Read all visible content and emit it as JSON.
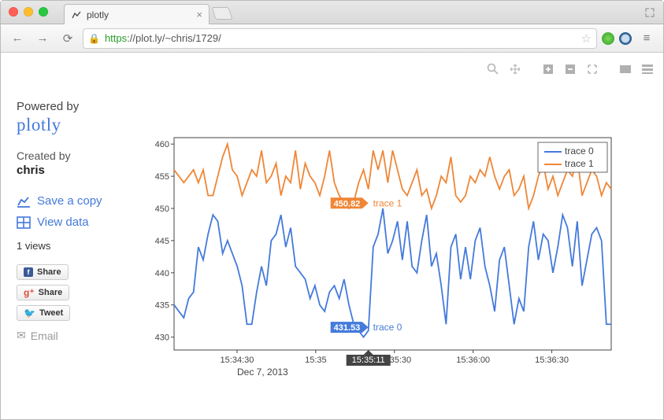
{
  "browser": {
    "tab_title": "plotly",
    "url_protocol": "https",
    "url_rest": "://plot.ly/~chris/1729/"
  },
  "toolbar": {
    "zoom": "Zoom",
    "pan": "Pan",
    "plus": "+",
    "minus": "−",
    "autoscale": "Autoscale"
  },
  "sidebar": {
    "powered_by": "Powered by",
    "logo": "plotly",
    "created_by": "Created by",
    "author": "chris",
    "save_copy": "Save a copy",
    "view_data": "View data",
    "views": "1 views",
    "share_fb": "Share",
    "share_gp": "Share",
    "share_tw": "Tweet",
    "email": "Email"
  },
  "chart_data": {
    "type": "line",
    "xlabel": "",
    "ylabel": "",
    "date_annotation": "Dec 7, 2013",
    "xticks": [
      "15:34:30",
      "15:35",
      "15:35:30",
      "15:36:00",
      "15:36:30"
    ],
    "yticks": [
      430,
      435,
      440,
      445,
      450,
      455,
      460
    ],
    "ylim": [
      428,
      461
    ],
    "legend": [
      "trace 0",
      "trace 1"
    ],
    "hover": {
      "x": "15:35:11",
      "trace0_value": "431.53",
      "trace0_name": "trace 0",
      "trace1_value": "450.82",
      "trace1_name": "trace 1"
    },
    "series": [
      {
        "name": "trace 0",
        "color": "#447adb",
        "values": [
          435,
          434,
          433,
          436,
          437,
          444,
          442,
          446,
          449,
          448,
          443,
          445,
          443,
          441,
          438,
          432,
          432,
          437,
          441,
          438,
          445,
          446,
          449,
          444,
          447,
          441,
          440,
          439,
          436,
          438,
          435,
          434,
          437,
          438,
          436,
          439,
          435,
          432,
          431,
          430,
          431,
          444,
          446,
          450,
          443,
          445,
          448,
          442,
          448,
          441,
          440,
          445,
          449,
          441,
          443,
          438,
          432,
          444,
          446,
          439,
          444,
          439,
          445,
          447,
          441,
          438,
          434,
          442,
          444,
          438,
          432,
          436,
          434,
          444,
          448,
          442,
          446,
          445,
          440,
          444,
          449,
          447,
          441,
          448,
          438,
          442,
          446,
          447,
          445,
          432,
          432
        ]
      },
      {
        "name": "trace 1",
        "color": "#ef8636",
        "values": [
          456,
          455,
          454,
          455,
          456,
          454,
          456,
          452,
          452,
          455,
          458,
          460,
          456,
          455,
          452,
          454,
          456,
          455,
          459,
          454,
          455,
          457,
          452,
          455,
          454,
          459,
          453,
          457,
          455,
          454,
          452,
          455,
          459,
          454,
          452,
          451,
          450,
          451,
          454,
          456,
          453,
          459,
          456,
          459,
          454,
          459,
          456,
          453,
          452,
          454,
          456,
          452,
          453,
          450,
          452,
          455,
          454,
          458,
          452,
          451,
          452,
          455,
          454,
          456,
          455,
          458,
          455,
          453,
          455,
          456,
          452,
          453,
          455,
          450,
          452,
          455,
          457,
          453,
          455,
          452,
          454,
          456,
          455,
          458,
          452,
          454,
          456,
          455,
          452,
          454,
          453
        ]
      }
    ]
  }
}
